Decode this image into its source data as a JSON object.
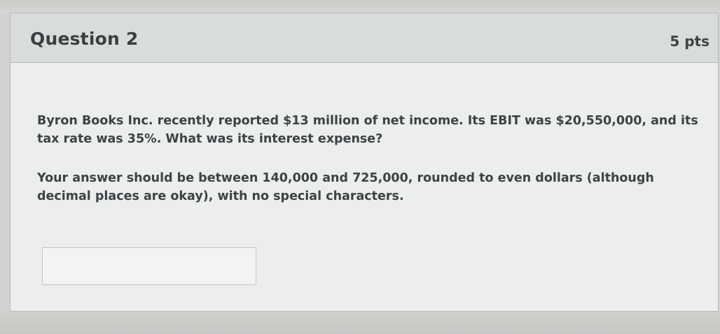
{
  "question": {
    "title": "Question 2",
    "points": "5 pts",
    "paragraphs": [
      "Byron Books Inc. recently reported $13 million of net income. Its EBIT was $20,550,000, and its tax rate was 35%. What was its interest expense?",
      "Your answer should be between 140,000 and 725,000, rounded to even dollars (although decimal places are okay), with no special characters."
    ]
  },
  "answer": {
    "value": ""
  }
}
